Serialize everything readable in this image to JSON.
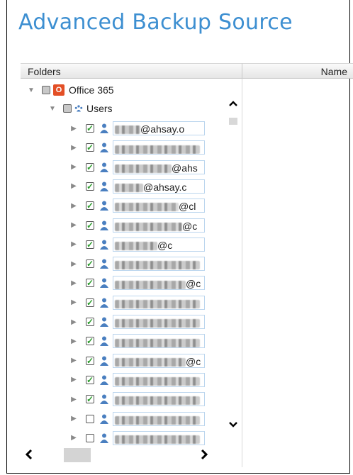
{
  "title": "Advanced Backup Source",
  "columns": {
    "folders": "Folders",
    "name": "Name"
  },
  "tree": {
    "root_label": "Office 365",
    "users_label": "Users",
    "users": [
      {
        "visible": "@ahsay.o",
        "checked": true,
        "blur_w": 36
      },
      {
        "visible": "",
        "checked": true,
        "blur_w": 120
      },
      {
        "visible": "@ahs",
        "checked": true,
        "blur_w": 80
      },
      {
        "visible": "@ahsay.c",
        "checked": true,
        "blur_w": 40
      },
      {
        "visible": "@cl",
        "checked": true,
        "blur_w": 90
      },
      {
        "visible": "@c",
        "checked": true,
        "blur_w": 95
      },
      {
        "visible": "@c",
        "checked": true,
        "blur_w": 60
      },
      {
        "visible": "",
        "checked": true,
        "blur_w": 120
      },
      {
        "visible": "@c",
        "checked": true,
        "blur_w": 100
      },
      {
        "visible": "",
        "checked": true,
        "blur_w": 120
      },
      {
        "visible": "",
        "checked": true,
        "blur_w": 120
      },
      {
        "visible": "",
        "checked": true,
        "blur_w": 120
      },
      {
        "visible": "@c",
        "checked": true,
        "blur_w": 100
      },
      {
        "visible": "",
        "checked": true,
        "blur_w": 120
      },
      {
        "visible": "",
        "checked": true,
        "blur_w": 120
      },
      {
        "visible": "",
        "checked": false,
        "blur_w": 120
      },
      {
        "visible": "",
        "checked": false,
        "blur_w": 120
      }
    ]
  },
  "icons": {
    "expand": "triangle-right-icon",
    "collapse": "triangle-down-icon",
    "office365": "office365-icon",
    "user": "user-icon",
    "users": "users-group-icon",
    "scroll_up": "chevron-up-icon",
    "scroll_down": "chevron-down-icon",
    "scroll_left": "chevron-left-icon",
    "scroll_right": "chevron-right-icon"
  },
  "colors": {
    "title": "#3d8fd1",
    "check": "#2b9b2b",
    "office": "#e34f26",
    "user_icon": "#4a7fc0"
  }
}
